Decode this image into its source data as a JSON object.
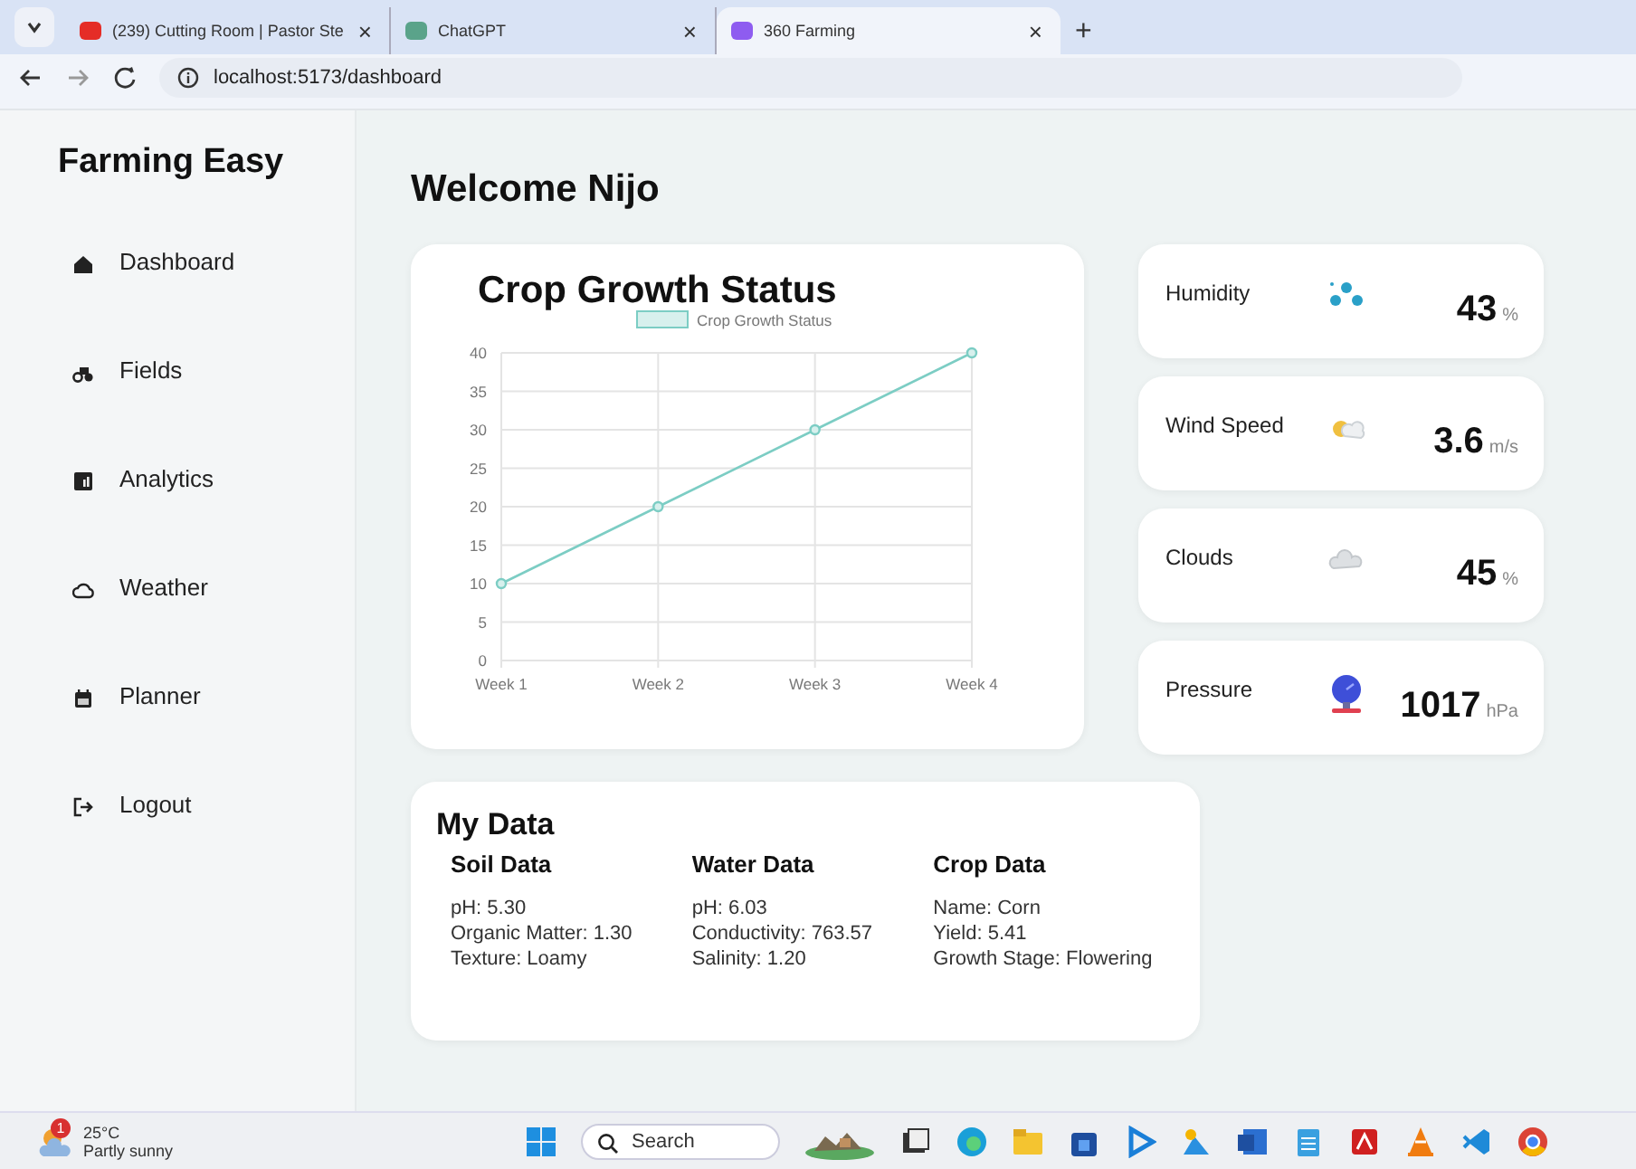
{
  "browser": {
    "tabs": [
      {
        "title": "(239) Cutting Room | Pastor Ste",
        "close": "×",
        "selected": false,
        "color": "#e52d27"
      },
      {
        "title": "ChatGPT",
        "close": "×",
        "selected": false,
        "color": "#5aa38a"
      },
      {
        "title": "360 Farming",
        "close": "×",
        "selected": true,
        "color": "#8e5cf0"
      }
    ],
    "new_tab": "+",
    "address": "localhost:5173/dashboard"
  },
  "sidebar": {
    "brand": "Farming Easy",
    "items": [
      {
        "label": "Dashboard"
      },
      {
        "label": "Fields"
      },
      {
        "label": "Analytics"
      },
      {
        "label": "Weather"
      },
      {
        "label": "Planner"
      },
      {
        "label": "Logout"
      }
    ]
  },
  "main": {
    "greeting": "Welcome Nijo",
    "growth": {
      "chart_data": {
        "type": "line",
        "title": "Crop Growth Status",
        "categories": [
          "Week 1",
          "Week 2",
          "Week 3",
          "Week 4"
        ],
        "series": [
          {
            "name": "Crop Growth Status",
            "color": "#7ccdc4",
            "values": [
              10,
              20,
              30,
              40
            ],
            "marker": true
          }
        ],
        "grid": true,
        "ylim": [
          0,
          40
        ],
        "yticks": [
          0,
          5,
          10,
          15,
          20,
          25,
          30,
          35,
          40
        ]
      }
    },
    "weather": [
      {
        "label": "Humidity",
        "value": "43",
        "unit": "%"
      },
      {
        "label": "Wind Speed",
        "value": "3.6",
        "unit": "m/s"
      },
      {
        "label": "Clouds",
        "value": "45",
        "unit": "%"
      },
      {
        "label": "Pressure",
        "value": "1017",
        "unit": "hPa"
      }
    ],
    "my_data": {
      "title": "My Data",
      "sections": [
        {
          "heading": "Soil Data",
          "lines": [
            "pH: 5.30",
            "Organic Matter: 1.30",
            "Texture: Loamy"
          ]
        },
        {
          "heading": "Water Data",
          "lines": [
            "pH: 6.03",
            "Conductivity: 763.57",
            "Salinity: 1.20"
          ]
        },
        {
          "heading": "Crop Data",
          "lines": [
            "Name: Corn",
            "Yield: 5.41",
            "Growth Stage: Flowering"
          ]
        }
      ]
    }
  },
  "taskbar": {
    "temperature": "25°C",
    "condition": "Partly sunny",
    "badge": "1",
    "search": {
      "placeholder": "Search"
    }
  }
}
